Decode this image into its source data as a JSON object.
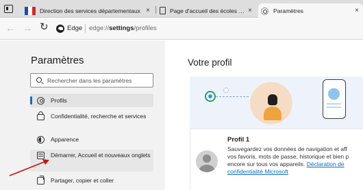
{
  "tabs": [
    {
      "title": "Direction des services départementaux",
      "close": "×"
    },
    {
      "title": "Page d'accueil des écoles publiques",
      "close": "×"
    },
    {
      "title": "Paramètres",
      "close": "×"
    }
  ],
  "address_bar": {
    "back_icon": "←",
    "forward_icon": "→",
    "refresh_icon": "↻",
    "browser_label": "Edge",
    "url_scheme": "edge://",
    "url_host": "settings",
    "url_path": "/profiles"
  },
  "sidebar": {
    "title": "Paramètres",
    "search_placeholder": "Rechercher dans les paramètres",
    "items": [
      {
        "label": "Profils",
        "icon": "profile-icon"
      },
      {
        "label": "Confidentialité, recherche et services",
        "icon": "lock-icon"
      },
      {
        "label": "Apparence",
        "icon": "appearance-icon"
      },
      {
        "label": "Démarrer, Accueil et nouveaux onglets",
        "icon": "window-icon"
      },
      {
        "label": "Partager, copier et coller",
        "icon": "share-icon"
      }
    ]
  },
  "main": {
    "heading": "Votre profil",
    "profile_card": {
      "name": "Profil 1",
      "desc_line1": "Sauvegardez vos données de navigation et aff",
      "desc_line2": "vos favoris, mots de passe, historique et bien p",
      "desc_line3": "encore sur tous vos appareils. ",
      "link_part1": "Déclaration de",
      "link_part2": "confidentialité Microsoft"
    }
  },
  "colors": {
    "accent": "#0f6cbd",
    "annotation_arrow": "#cc1010",
    "sidebar_bg": "#f2f2f2",
    "hero_bg": "#eef3fb"
  }
}
